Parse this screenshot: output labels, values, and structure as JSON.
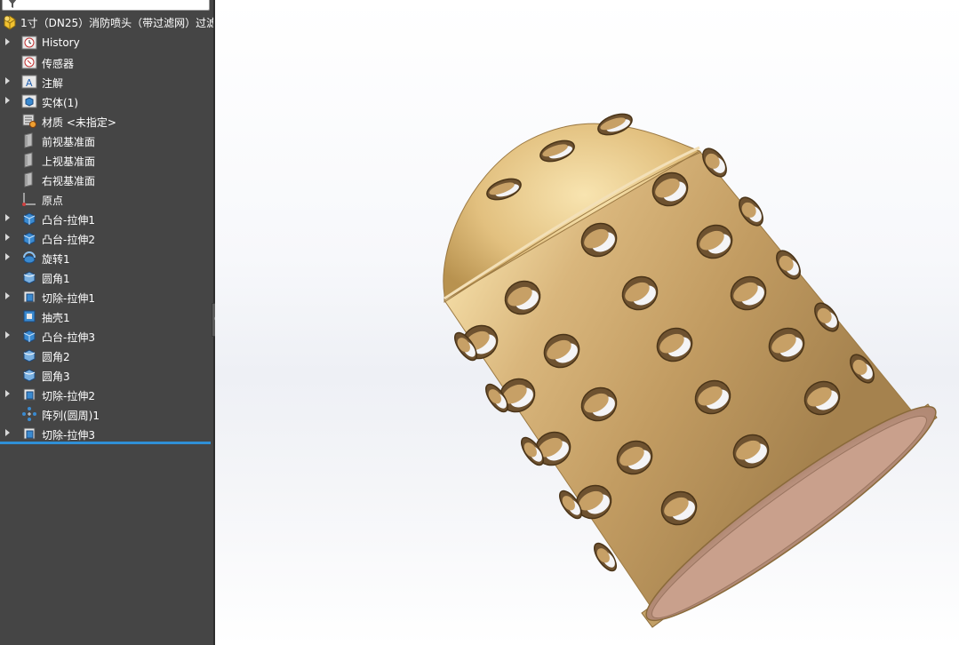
{
  "tree": {
    "root_label": "1寸（DN25）消防喷头（带过滤网）过滤",
    "items": [
      {
        "label": "History",
        "icon": "history-icon",
        "expandable": true
      },
      {
        "label": "传感器",
        "icon": "sensor-icon",
        "expandable": false
      },
      {
        "label": "注解",
        "icon": "annotation-icon",
        "expandable": true
      },
      {
        "label": "实体(1)",
        "icon": "solid-bodies-icon",
        "expandable": true
      },
      {
        "label": "材质 <未指定>",
        "icon": "material-icon",
        "expandable": false
      },
      {
        "label": "前视基准面",
        "icon": "plane-icon",
        "expandable": false
      },
      {
        "label": "上视基准面",
        "icon": "plane-icon",
        "expandable": false
      },
      {
        "label": "右视基准面",
        "icon": "plane-icon",
        "expandable": false
      },
      {
        "label": "原点",
        "icon": "origin-icon",
        "expandable": false
      },
      {
        "label": "凸台-拉伸1",
        "icon": "boss-extrude-icon",
        "expandable": true
      },
      {
        "label": "凸台-拉伸2",
        "icon": "boss-extrude-icon",
        "expandable": true
      },
      {
        "label": "旋转1",
        "icon": "revolve-icon",
        "expandable": true
      },
      {
        "label": "圆角1",
        "icon": "fillet-icon",
        "expandable": false
      },
      {
        "label": "切除-拉伸1",
        "icon": "cut-extrude-icon",
        "expandable": true
      },
      {
        "label": "抽壳1",
        "icon": "shell-icon",
        "expandable": false
      },
      {
        "label": "凸台-拉伸3",
        "icon": "boss-extrude-icon",
        "expandable": true
      },
      {
        "label": "圆角2",
        "icon": "fillet-icon",
        "expandable": false
      },
      {
        "label": "圆角3",
        "icon": "fillet-icon",
        "expandable": false
      },
      {
        "label": "切除-拉伸2",
        "icon": "cut-extrude-icon",
        "expandable": true
      },
      {
        "label": "阵列(圆周)1",
        "icon": "circular-pattern-icon",
        "expandable": false
      },
      {
        "label": "切除-拉伸3",
        "icon": "cut-extrude-icon",
        "expandable": true
      }
    ]
  },
  "colors": {
    "panel_bg": "#454545",
    "rollback_bar": "#2f8fd6",
    "brass_light": "#e8c88a",
    "brass_mid": "#c9a26a",
    "brass_dark": "#8a6a3a"
  }
}
